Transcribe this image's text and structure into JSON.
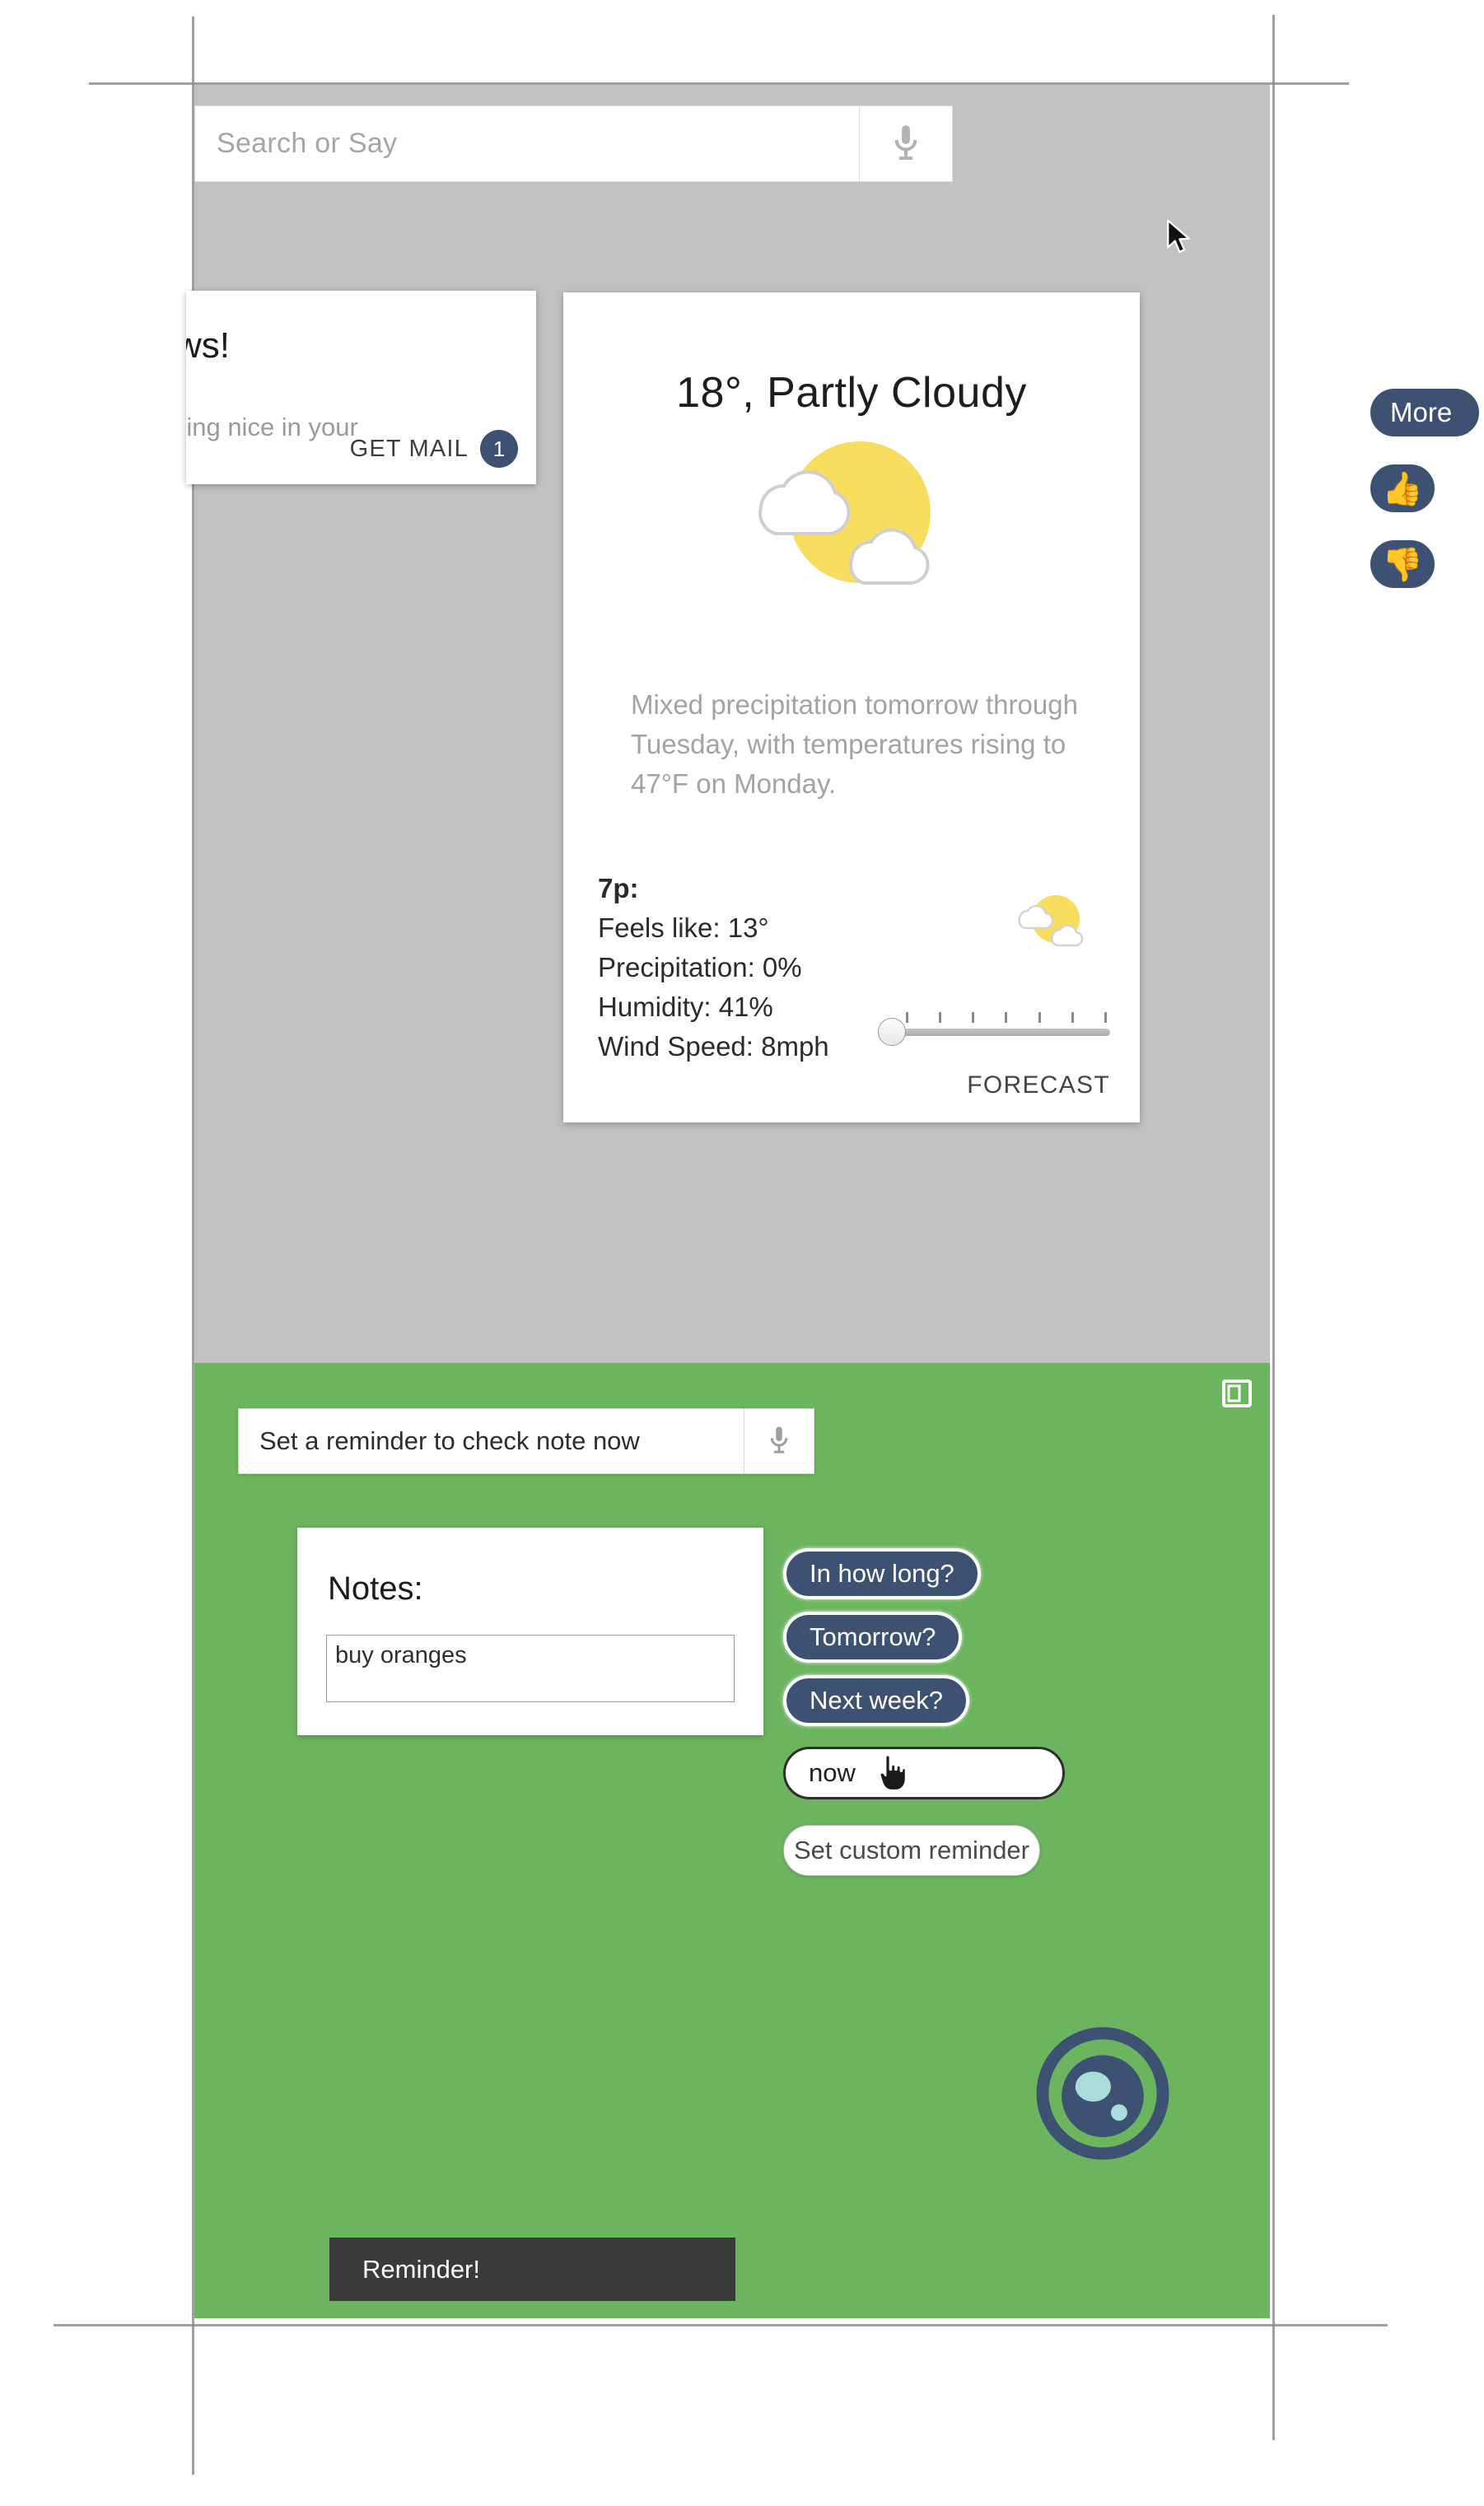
{
  "search": {
    "placeholder": "Search or Say",
    "mic_icon": "microphone-icon"
  },
  "mail_card": {
    "title": "news!",
    "subtitle": "nething nice in your",
    "action_label": "GET MAIL",
    "badge_count": "1"
  },
  "weather_card": {
    "headline": "18°, Partly Cloudy",
    "condition_icon": "partly-cloudy-icon",
    "description": "Mixed precipitation tomorrow through Tuesday, with temperatures rising to 47°F on Monday.",
    "hour_label": "7p:",
    "feels_like": "Feels like: 13°",
    "precipitation": "Precipitation: 0%",
    "humidity": "Humidity: 41%",
    "wind_speed": "Wind Speed: 8mph",
    "forecast_link": "FORECAST",
    "slider_ticks": 8,
    "slider_value_pct": 0
  },
  "rail": {
    "more_label": "More",
    "thumbs_up": "👍",
    "thumbs_down": "👎"
  },
  "reminder_panel": {
    "layout_icon": "split-pane-icon",
    "input_value": "Set a reminder to check note now",
    "mic_icon": "microphone-icon",
    "notes_title": "Notes:",
    "notes_value": "buy oranges",
    "chips": [
      {
        "label": "In how long?"
      },
      {
        "label": "Tomorrow?"
      },
      {
        "label": "Next week?"
      }
    ],
    "time_value": "now",
    "custom_button_label": "Set custom reminder",
    "orb_icon": "assistant-orb-icon"
  },
  "toast": {
    "message": "Reminder!"
  },
  "colors": {
    "accent_navy": "#3d5272",
    "panel_green": "#6cb55f",
    "app_grey": "#c3c0c0",
    "sun_yellow": "#f7dd5e",
    "toast_dark": "#3a3a3a"
  }
}
